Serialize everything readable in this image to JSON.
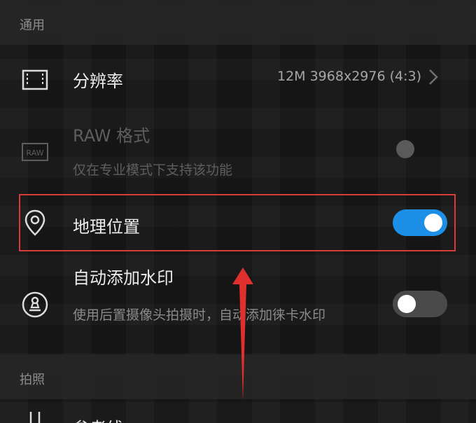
{
  "sections": {
    "general": "通用",
    "photo": "拍照"
  },
  "resolution": {
    "title": "分辨率",
    "value": "12M 3968x2976 (4:3)"
  },
  "raw": {
    "title": "RAW 格式",
    "subtitle": "仅在专业模式下支持该功能",
    "icon_text": "RAW"
  },
  "location": {
    "title": "地理位置",
    "enabled": true
  },
  "watermark": {
    "title": "自动添加水印",
    "subtitle": "使用后置摄像头拍摄时，自动添加徕卡水印",
    "enabled": false
  },
  "next_row": {
    "title": "参考线"
  },
  "colors": {
    "toggle_on": "#1e8fe6",
    "highlight": "#d93a3a"
  }
}
